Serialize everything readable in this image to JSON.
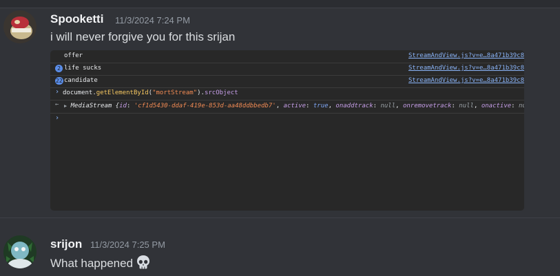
{
  "messages": [
    {
      "author": "Spooketti",
      "timestamp": "11/3/2024 7:24 PM",
      "text": "i will never forgive you for this srijan"
    },
    {
      "author": "srijon",
      "timestamp": "11/3/2024 7:25 PM",
      "text": "What happened"
    }
  ],
  "console": {
    "rows": [
      {
        "count": "",
        "text": "offer",
        "source": "StreamAndView.js?v=e…8a471b39c8"
      },
      {
        "count": "2",
        "text": "life sucks",
        "source": "StreamAndView.js?v=e…8a471b39c8"
      },
      {
        "count": "22",
        "text": "candidate",
        "source": "StreamAndView.js?v=e…8a471b39c8"
      }
    ],
    "input": {
      "obj": "document.",
      "method": "getElementById",
      "open": "(",
      "arg": "\"mortStream\"",
      "close": ").",
      "prop": "srcObject"
    },
    "result": {
      "type": "MediaStream",
      "open": " {",
      "k1": "id",
      "v1": "'cf1d5430-ddaf-419e-853d-aa48ddbbedb7'",
      "k2": "active",
      "v2": "true",
      "k3": "onaddtrack",
      "v3": "null",
      "k4": "onremovetrack",
      "v4": "null",
      "k5": "onactive",
      "v5": "null"
    },
    "prompt_glyph": "›",
    "return_glyph": "←",
    "expand_glyph": "▶"
  },
  "emoji": {
    "name": "skull-emoji"
  }
}
